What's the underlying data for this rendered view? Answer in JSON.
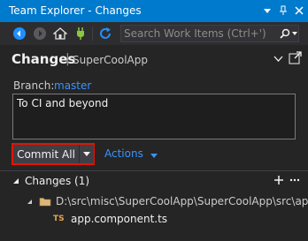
{
  "window": {
    "title": "Team Explorer - Changes"
  },
  "toolbar": {
    "search_placeholder": "Search Work Items (Ctrl+')"
  },
  "header": {
    "title": "Changes",
    "separator": "|",
    "repo": "SuperCoolApp"
  },
  "branch": {
    "label": "Branch:",
    "name": "master"
  },
  "commit": {
    "message": "To CI and beyond",
    "button_label": "Commit All",
    "actions_label": "Actions"
  },
  "changes": {
    "header": "Changes (1)",
    "folder_path": "D:\\src\\misc\\SuperCoolApp\\SuperCoolApp\\src\\app",
    "files": [
      {
        "type_badge": "TS",
        "name": "app.component.ts"
      }
    ]
  },
  "colors": {
    "titlebar": "#007acc",
    "background": "#252526",
    "link": "#3794ff",
    "highlight_border": "#e51400"
  }
}
